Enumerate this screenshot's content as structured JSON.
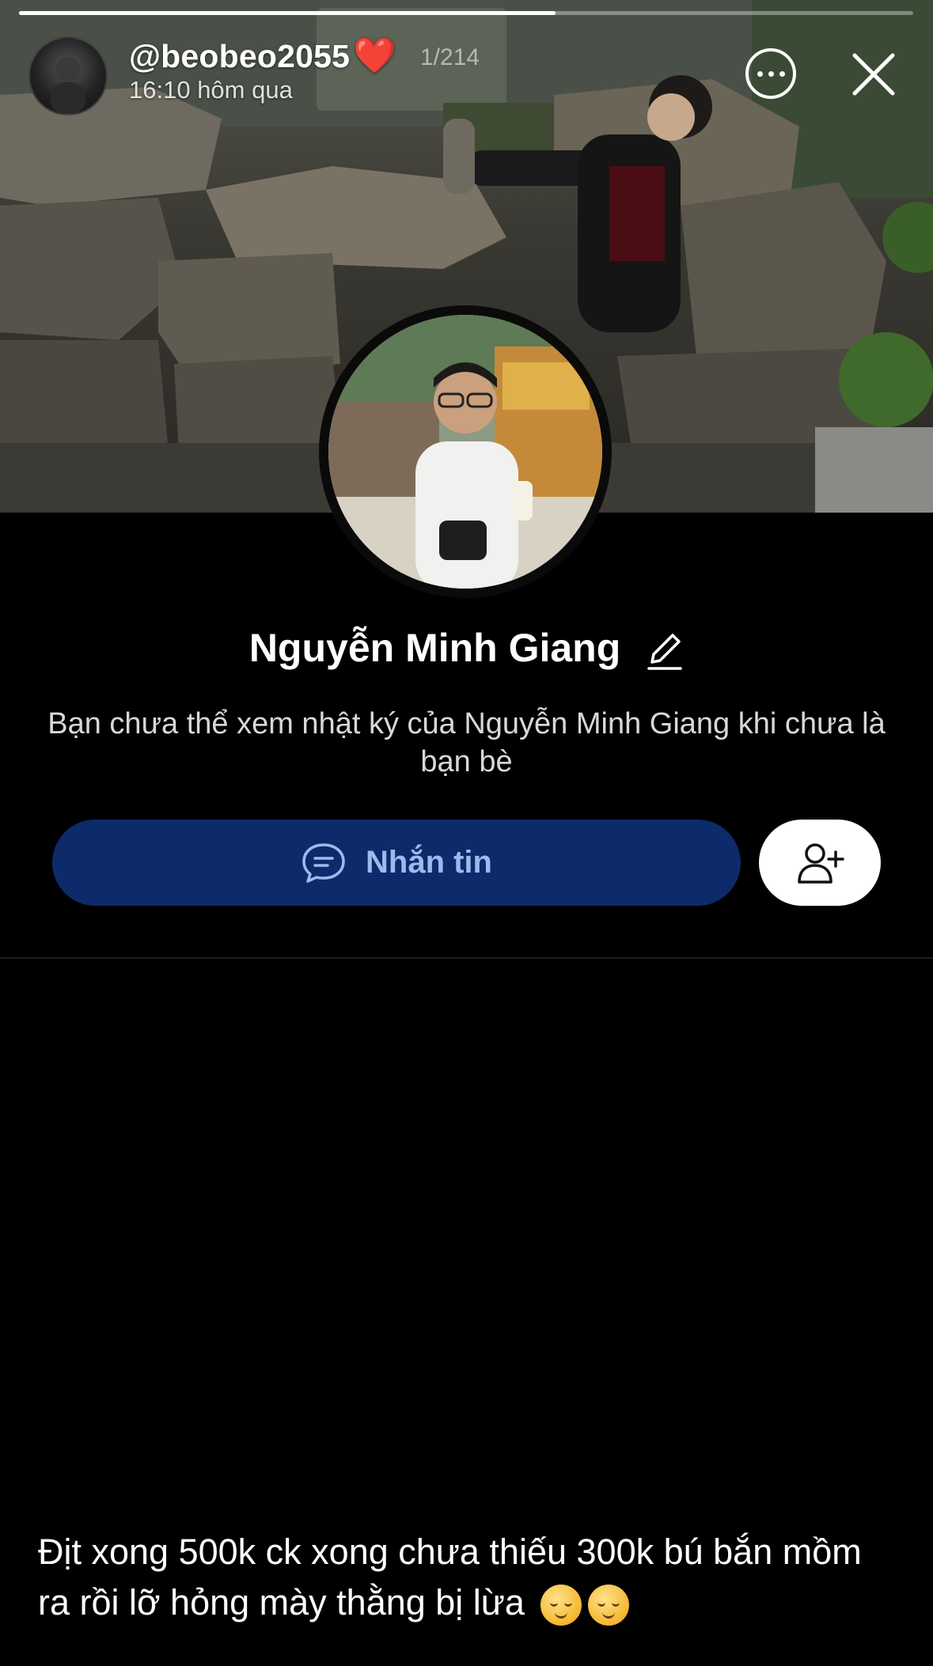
{
  "story": {
    "username": "@beobeo2055",
    "heart_emoji": "❤️",
    "counter": "1/214",
    "timestamp": "16:10 hôm qua",
    "progress": 0.6
  },
  "profile": {
    "name": "Nguyễn Minh Giang",
    "notice": "Bạn chưa thể xem nhật ký của Nguyễn Minh Giang khi chưa là bạn bè"
  },
  "actions": {
    "message_label": "Nhắn tin"
  },
  "caption": {
    "text": "Địt xong 500k ck xong chưa thiếu 300k bú bắn mồm ra rồi lỡ hỏng mày thằng bị lừa"
  },
  "colors": {
    "message_button_bg": "#0d2a6b",
    "message_button_text": "#9fb9ee",
    "background": "#000000"
  },
  "icons": [
    "more-options-icon",
    "close-icon",
    "edit-pencil-icon",
    "chat-bubble-icon",
    "add-friend-icon",
    "relieved-face-emoji"
  ]
}
